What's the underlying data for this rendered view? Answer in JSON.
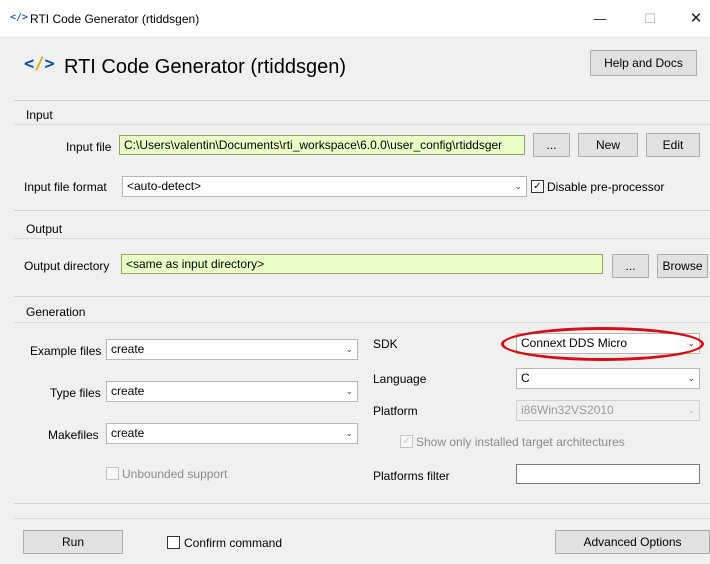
{
  "window": {
    "app_icon_glyph": "</>",
    "title": "RTI Code Generator (rtiddsgen)",
    "minimize_glyph": "—",
    "maximize_glyph": "☐",
    "close_glyph": "✕"
  },
  "header": {
    "icon_left": "<",
    "icon_slash": "/",
    "icon_right": ">",
    "title": "RTI Code Generator (rtiddsgen)",
    "help_label": "Help and Docs"
  },
  "input": {
    "section_label": "Input",
    "file_label": "Input file",
    "file_value": "C:\\Users\\valentin\\Documents\\rti_workspace\\6.0.0\\user_config\\rtiddsger",
    "browse_label": "...",
    "new_label": "New",
    "edit_label": "Edit",
    "format_label": "Input file format",
    "format_value": "<auto-detect>",
    "disable_preprocessor_label": "Disable pre-processor",
    "disable_preprocessor_checked": true
  },
  "output": {
    "section_label": "Output",
    "dir_label": "Output directory",
    "dir_value": "<same as input directory>",
    "dots_label": "...",
    "browse_label": "Browse"
  },
  "generation": {
    "section_label": "Generation",
    "example_files_label": "Example files",
    "example_files_value": "create",
    "type_files_label": "Type files",
    "type_files_value": "create",
    "makefiles_label": "Makefiles",
    "makefiles_value": "create",
    "unbounded_label": "Unbounded support",
    "unbounded_checked": false,
    "sdk_label": "SDK",
    "sdk_value": "Connext DDS Micro",
    "language_label": "Language",
    "language_value": "C",
    "platform_label": "Platform",
    "platform_value": "i86Win32VS2010",
    "show_installed_label": "Show only installed target architectures",
    "show_installed_checked": true,
    "platforms_filter_label": "Platforms filter",
    "platforms_filter_value": ""
  },
  "footer": {
    "run_label": "Run",
    "confirm_label": "Confirm command",
    "confirm_checked": false,
    "advanced_label": "Advanced Options"
  },
  "icons": {
    "dropdown": "chevron-down-icon",
    "check": "checkmark-icon"
  },
  "colors": {
    "field_highlight": "#eaffc8",
    "annotation_ring": "#d40f14",
    "code_icon": "#0a4ea3"
  }
}
